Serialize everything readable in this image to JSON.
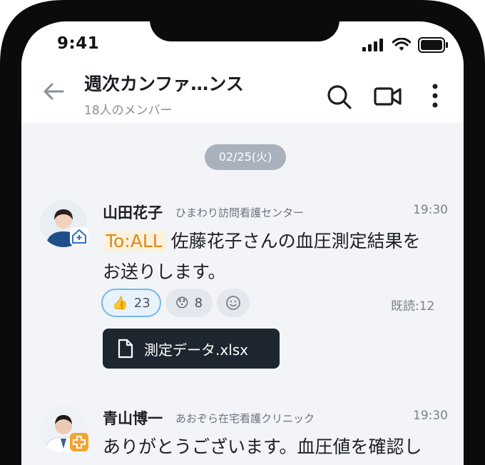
{
  "status": {
    "time": "9:41"
  },
  "header": {
    "title": "週次カンファ…ンス",
    "subtitle": "18人のメンバー"
  },
  "chat": {
    "date": "02/25(火)",
    "messages": [
      {
        "name": "山田花子",
        "org": "ひまわり訪問看護センター",
        "time": "19:30",
        "mention": "To:ALL",
        "text_line1": "佐藤花子さんの血圧測定結果を",
        "text_line2": "お送りします。",
        "reactions": [
          {
            "emoji": "👍",
            "count": "23",
            "active": true
          },
          {
            "emoji": "😯",
            "count": "8",
            "active": false
          }
        ],
        "read": "既読:12",
        "file": "測定データ.xlsx"
      },
      {
        "name": "青山博一",
        "org": "あおぞら在宅看護クリニック",
        "time": "19:30",
        "text_line1": "ありがとうございます。血圧値を確認し"
      }
    ]
  },
  "icons": {
    "back": "arrow-left-icon",
    "search": "search-icon",
    "video": "video-camera-icon",
    "more": "more-vertical-icon",
    "add_reaction": "smiley-add-icon",
    "file": "document-icon",
    "home_badge": "home-medical-badge-icon",
    "clinic_badge": "medical-cross-badge-icon"
  },
  "colors": {
    "accent": "#77b7e8",
    "mention_bg": "#fdf1dc",
    "mention_text": "#d98a1a",
    "file_bg": "#1e2630",
    "chat_bg": "#f2f4f7",
    "date_pill": "#a9b1bd",
    "clinic_badge": "#f2a531"
  }
}
